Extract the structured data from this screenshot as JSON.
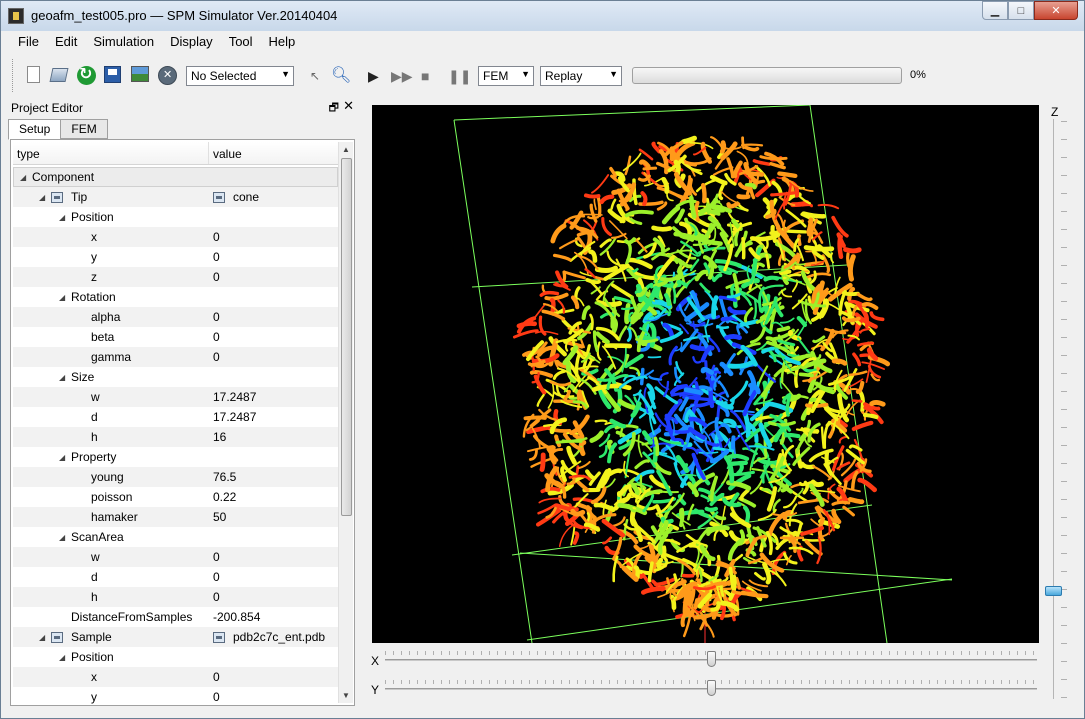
{
  "window": {
    "title": "geoafm_test005.pro — SPM Simulator Ver.20140404",
    "min": "▁",
    "max": "□",
    "close": "✕"
  },
  "menu": [
    "File",
    "Edit",
    "Simulation",
    "Display",
    "Tool",
    "Help"
  ],
  "toolbar": {
    "target_select": "No Selected",
    "mode_select": "FEM",
    "replay_select": "Replay",
    "progress_percent": 0,
    "progress_label": "0%"
  },
  "project_editor": {
    "title": "Project Editor",
    "tabs": [
      "Setup",
      "FEM"
    ],
    "columns": [
      "type",
      "value"
    ],
    "rows": [
      {
        "name": "Component",
        "value": "",
        "level": 0,
        "expander": true,
        "icon": false,
        "section": true
      },
      {
        "name": "Tip",
        "value": "cone",
        "level": 1,
        "expander": true,
        "icon": true,
        "value_icon": true
      },
      {
        "name": "Position",
        "value": "",
        "level": 2,
        "expander": true
      },
      {
        "name": "x",
        "value": "0",
        "level": 3
      },
      {
        "name": "y",
        "value": "0",
        "level": 3
      },
      {
        "name": "z",
        "value": "0",
        "level": 3
      },
      {
        "name": "Rotation",
        "value": "",
        "level": 2,
        "expander": true
      },
      {
        "name": "alpha",
        "value": "0",
        "level": 3
      },
      {
        "name": "beta",
        "value": "0",
        "level": 3
      },
      {
        "name": "gamma",
        "value": "0",
        "level": 3
      },
      {
        "name": "Size",
        "value": "",
        "level": 2,
        "expander": true
      },
      {
        "name": "w",
        "value": "17.2487",
        "level": 3
      },
      {
        "name": "d",
        "value": "17.2487",
        "level": 3
      },
      {
        "name": "h",
        "value": "16",
        "level": 3
      },
      {
        "name": "Property",
        "value": "",
        "level": 2,
        "expander": true
      },
      {
        "name": "young",
        "value": "76.5",
        "level": 3
      },
      {
        "name": "poisson",
        "value": "0.22",
        "level": 3
      },
      {
        "name": "hamaker",
        "value": "50",
        "level": 3
      },
      {
        "name": "ScanArea",
        "value": "",
        "level": 2,
        "expander": true
      },
      {
        "name": "w",
        "value": "0",
        "level": 3
      },
      {
        "name": "d",
        "value": "0",
        "level": 3
      },
      {
        "name": "h",
        "value": "0",
        "level": 3
      },
      {
        "name": "DistanceFromSamples",
        "value": "-200.854",
        "level": 2
      },
      {
        "name": "Sample",
        "value": "pdb2c7c_ent.pdb",
        "level": 1,
        "expander": true,
        "icon": true,
        "value_icon": true
      },
      {
        "name": "Position",
        "value": "",
        "level": 2,
        "expander": true
      },
      {
        "name": "x",
        "value": "0",
        "level": 3
      },
      {
        "name": "y",
        "value": "0",
        "level": 3
      }
    ]
  },
  "viewport": {
    "z_label": "Z",
    "x_label": "X",
    "y_label": "Y",
    "x_slider": 0.5,
    "y_slider": 0.5,
    "z_slider": 0.82,
    "colors": [
      "#1e3cff",
      "#1a8cff",
      "#19d6e8",
      "#2ee86b",
      "#9cf02a",
      "#f2f21c",
      "#ff9a1a",
      "#ff3a14"
    ],
    "frame_color": "#7cff5c"
  }
}
